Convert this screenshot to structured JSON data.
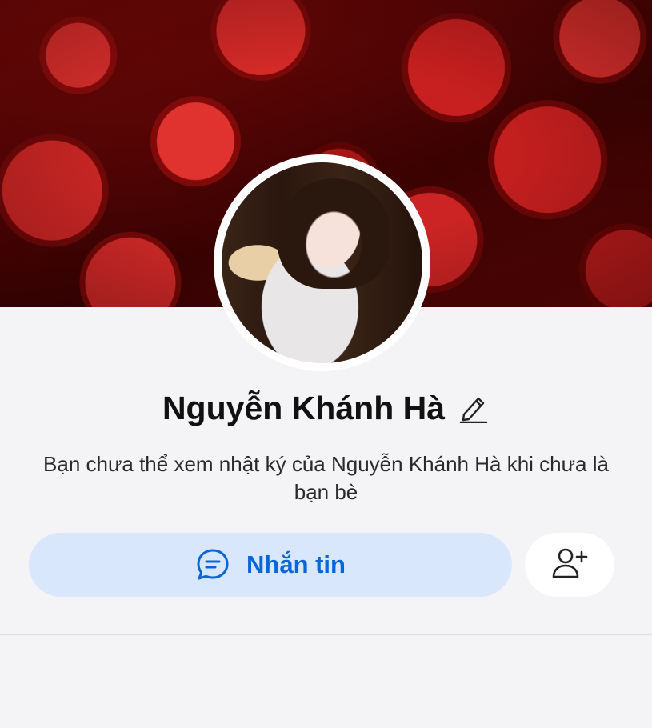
{
  "profile": {
    "name": "Nguyễn Khánh Hà",
    "notice": "Bạn chưa thể xem nhật ký của Nguyễn Khánh Hà khi chưa là bạn bè"
  },
  "actions": {
    "message_label": "Nhắn tin",
    "message_icon": "chat-bubble-icon",
    "add_friend_icon": "add-friend-icon",
    "edit_icon": "pencil-icon"
  },
  "colors": {
    "accent": "#0a66d8",
    "message_button_bg": "#d8e7fb",
    "page_bg": "#f4f4f6"
  }
}
